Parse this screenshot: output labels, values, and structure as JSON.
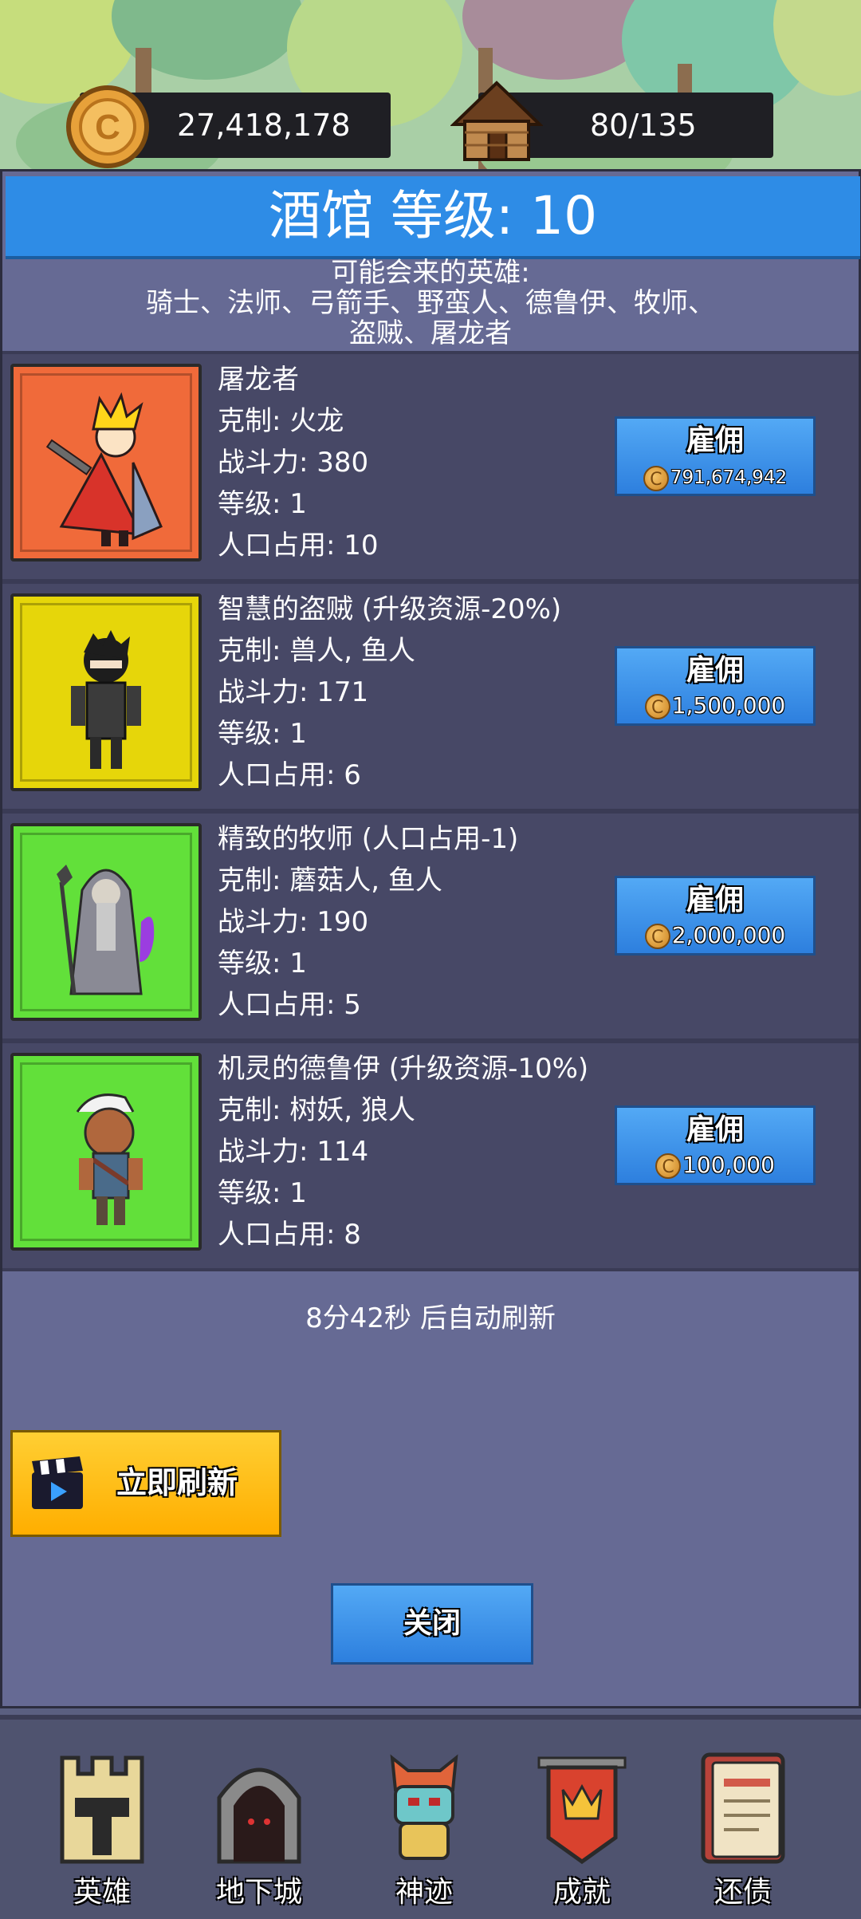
{
  "resources": {
    "gold": "27,418,178",
    "population": "80/135",
    "coin_icon": "coin-icon",
    "house_icon": "house-icon"
  },
  "tavern": {
    "title": "酒馆 等级: 10",
    "possible_heroes_label": "可能会来的英雄:",
    "possible_heroes_line1": "骑士、法师、弓箭手、野蛮人、德鲁伊、牧师、",
    "possible_heroes_line2": "盗贼、屠龙者"
  },
  "heroes": [
    {
      "name": "屠龙者",
      "counter": "克制: 火龙",
      "power": "战斗力: 380",
      "level": "等级: 1",
      "population": "人口占用: 10",
      "hire_label": "雇佣",
      "price": "791,674,942",
      "portrait_color": "#f06a3a",
      "portrait_icon": "dragon-slayer-portrait"
    },
    {
      "name": "智慧的盗贼 (升级资源-20%)",
      "counter": "克制: 兽人, 鱼人",
      "power": "战斗力: 171",
      "level": "等级: 1",
      "population": "人口占用: 6",
      "hire_label": "雇佣",
      "price": "1,500,000",
      "portrait_color": "#e6d60a",
      "portrait_icon": "thief-portrait"
    },
    {
      "name": "精致的牧师 (人口占用-1)",
      "counter": "克制: 蘑菇人, 鱼人",
      "power": "战斗力: 190",
      "level": "等级: 1",
      "population": "人口占用: 5",
      "hire_label": "雇佣",
      "price": "2,000,000",
      "portrait_color": "#62e03a",
      "portrait_icon": "priest-portrait"
    },
    {
      "name": "机灵的德鲁伊 (升级资源-10%)",
      "counter": "克制: 树妖, 狼人",
      "power": "战斗力: 114",
      "level": "等级: 1",
      "population": "人口占用: 8",
      "hire_label": "雇佣",
      "price": "100,000",
      "portrait_color": "#62e03a",
      "portrait_icon": "druid-portrait"
    }
  ],
  "refresh": {
    "timer_text": "8分42秒 后自动刷新",
    "refresh_now_label": "立即刷新",
    "video_icon": "clapperboard-icon"
  },
  "close_label": "关闭",
  "bottom_nav": [
    {
      "label": "英雄",
      "icon": "castle-tower-icon"
    },
    {
      "label": "地下城",
      "icon": "dungeon-gate-icon"
    },
    {
      "label": "神迹",
      "icon": "totem-icon"
    },
    {
      "label": "成就",
      "icon": "crown-banner-icon"
    },
    {
      "label": "还债",
      "icon": "ledger-book-icon"
    }
  ],
  "colors": {
    "title_blue": "#2e8ce6",
    "panel": "#666a94",
    "card": "#474866",
    "refresh_yellow": "#ffbb00"
  }
}
